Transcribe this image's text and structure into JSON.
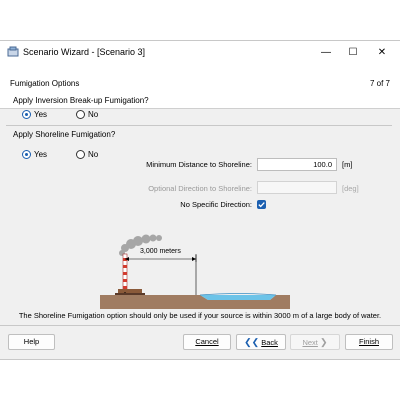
{
  "window": {
    "title": "Scenario Wizard - [Scenario 3]",
    "controls": {
      "minimize": "—",
      "maximize": "☐",
      "close": "✕"
    }
  },
  "header": {
    "title": "Fumigation Options",
    "page": "7 of 7"
  },
  "inversion": {
    "question": "Apply Inversion Break-up Fumigation?",
    "yes_label": "Yes",
    "no_label": "No",
    "selected": "Yes"
  },
  "shoreline": {
    "question": "Apply Shoreline Fumigation?",
    "yes_label": "Yes",
    "no_label": "No",
    "selected": "Yes",
    "min_distance_label": "Minimum Distance to Shoreline:",
    "min_distance_value": "100.0",
    "min_distance_unit": "[m]",
    "direction_label": "Optional Direction to Shoreline:",
    "direction_value": "",
    "direction_unit": "[deg]",
    "no_direction_label": "No Specific Direction:",
    "no_direction_checked": true
  },
  "diagram": {
    "distance_label": "3,000 meters"
  },
  "note": "The Shoreline Fumigation option should only be used if your source is within 3000 m of a large body of water.",
  "buttons": {
    "help": "Help",
    "cancel": "Cancel",
    "back": "Back",
    "next": "Next",
    "finish": "Finish"
  },
  "colors": {
    "accent": "#1b5fb0",
    "water": "#6cc3e8",
    "ground": "#a07c62"
  }
}
